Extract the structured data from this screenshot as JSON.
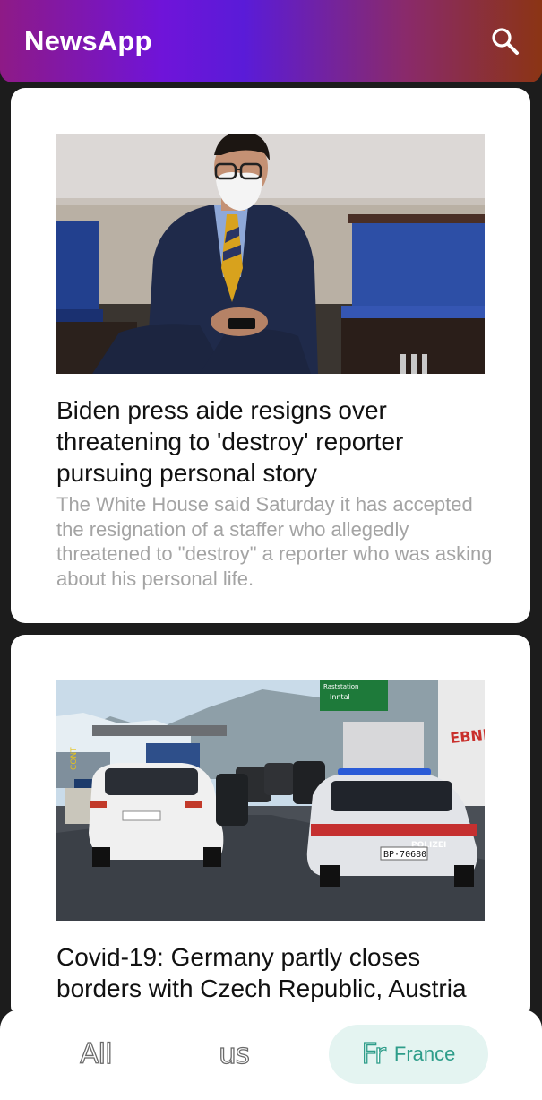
{
  "appbar": {
    "title": "NewsApp",
    "search_icon": "search-icon",
    "gradient": [
      "#8e1a86",
      "#6f14d9",
      "#8b3414"
    ]
  },
  "articles": [
    {
      "headline": "Biden press aide resigns over threatening to 'destroy' reporter pursuing personal story",
      "summary": "The White House said Saturday it has accepted the resignation of a staffer who allegedly threatened to \"destroy\" a reporter who was asking about his personal life."
    },
    {
      "headline": "Covid-19: Germany partly closes borders with Czech Republic, Austria",
      "summary": ""
    }
  ],
  "images": {
    "sign_line1": "Raststation",
    "sign_line2": "Inntal",
    "truck_brand": "EBNER",
    "police_label": "POLIZEI",
    "plate": "BP·70680",
    "barrier_text": "CONT"
  },
  "tabs": [
    {
      "glyph": "All",
      "label": ""
    },
    {
      "glyph": "us",
      "label": ""
    },
    {
      "glyph": "Fr",
      "label": "France",
      "selected": true
    }
  ],
  "colors": {
    "selected_tab_bg": "#e4f4f1",
    "selected_tab_fg": "#2e9d8a",
    "summary_text": "#a4a4a4"
  }
}
